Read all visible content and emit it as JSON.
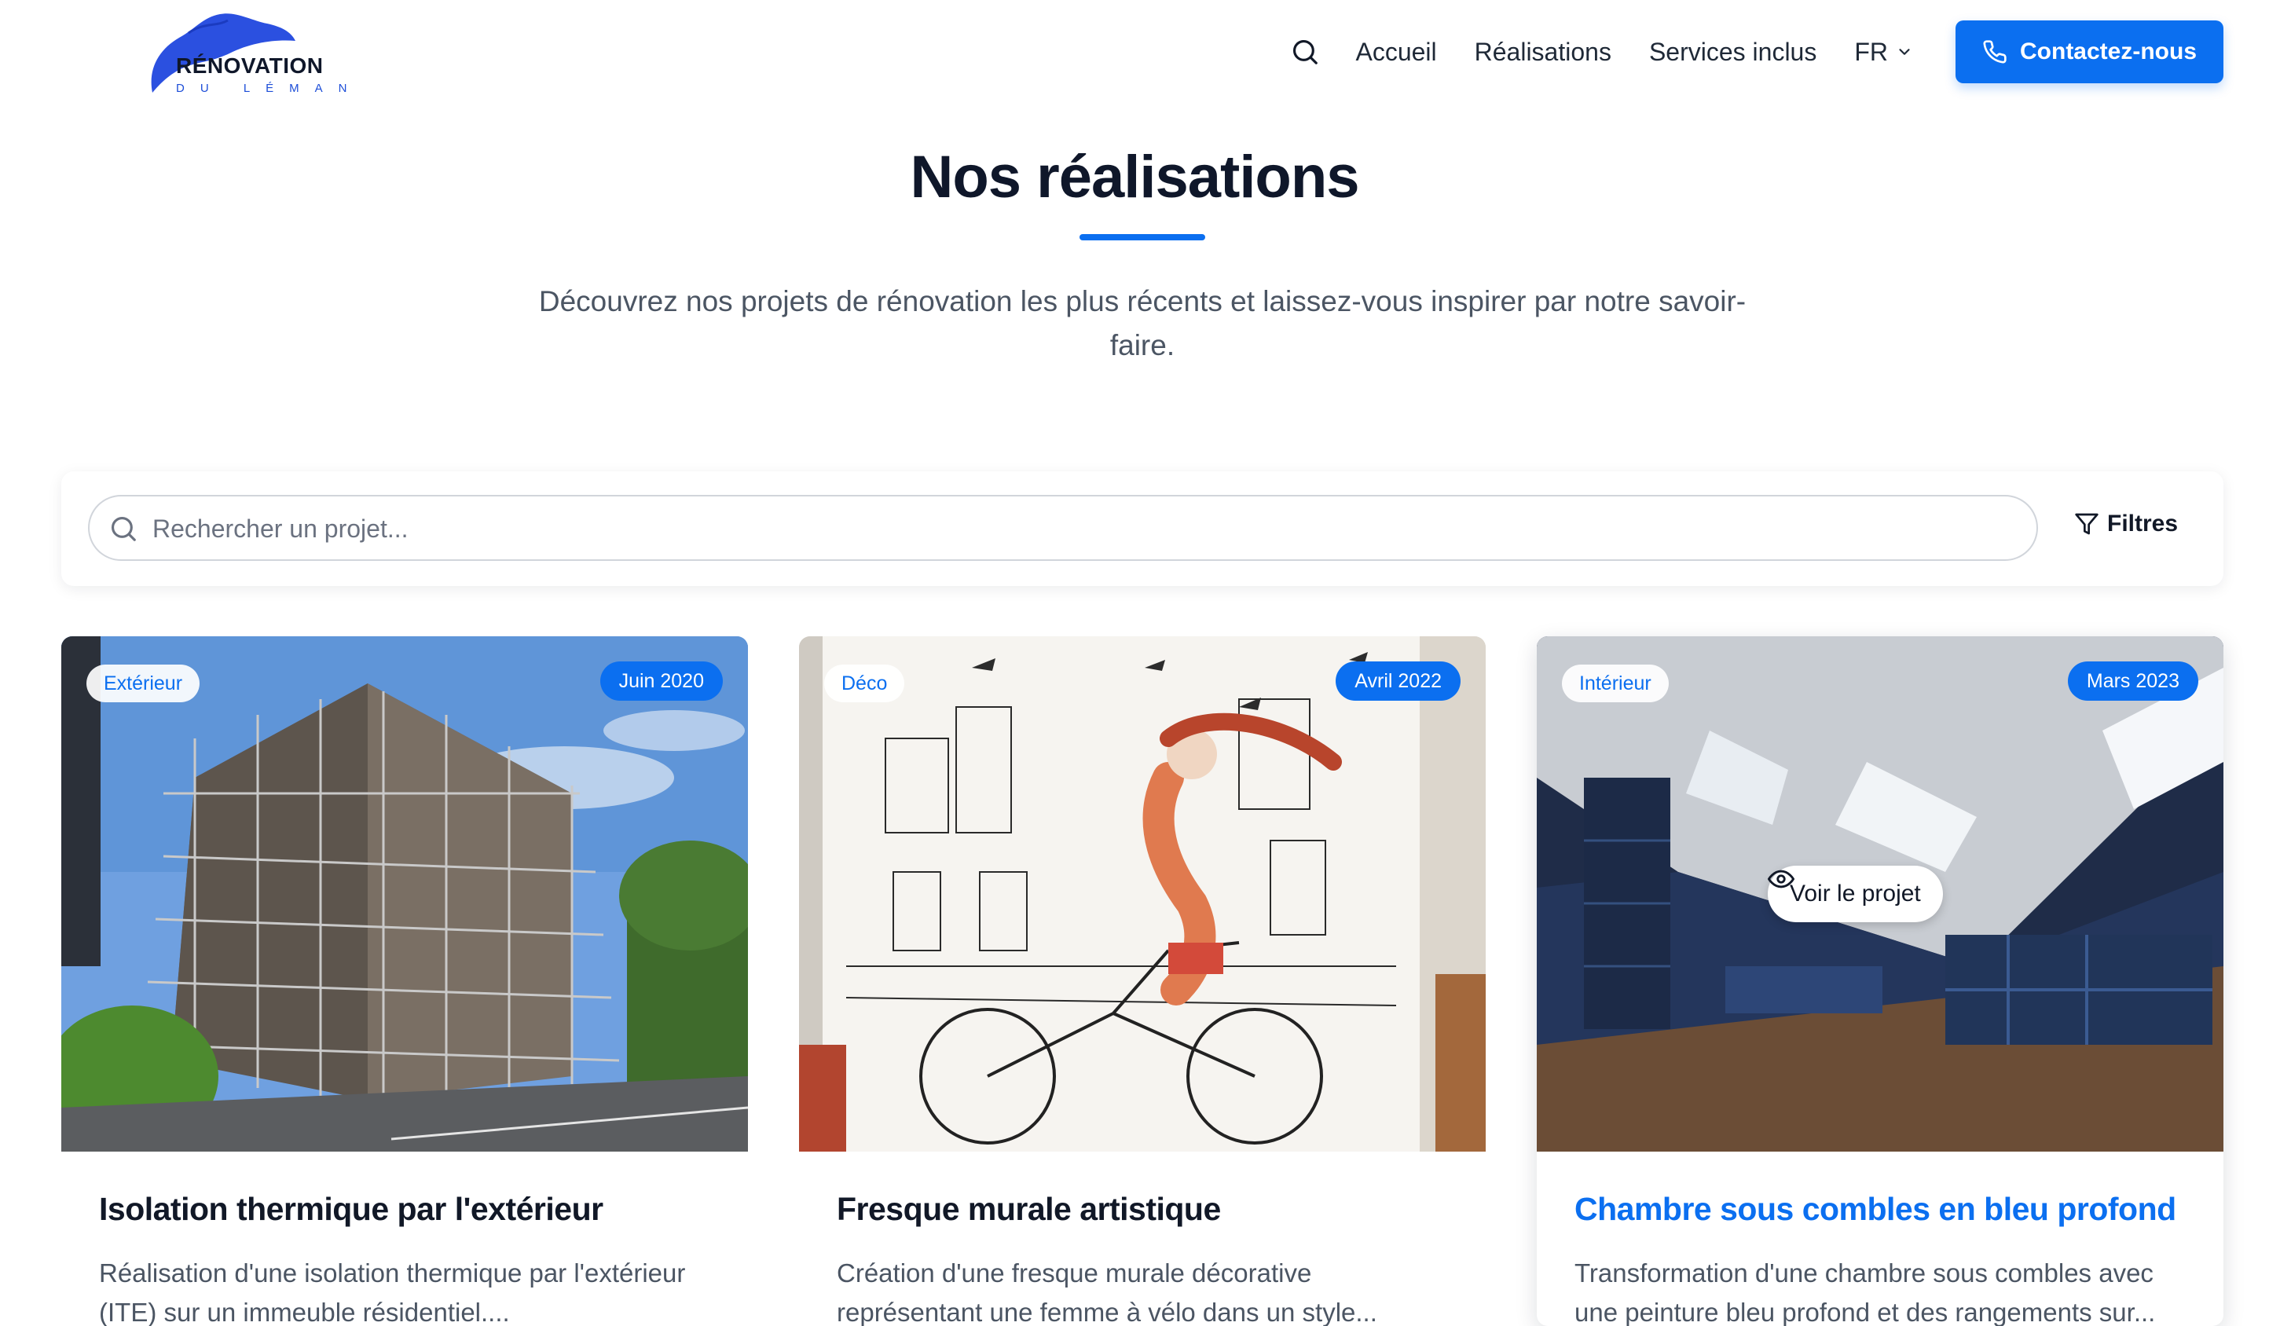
{
  "header": {
    "logo": {
      "word": "RÉNOVATION",
      "sub": "DU LÉMAN"
    },
    "nav": [
      {
        "label": "Accueil"
      },
      {
        "label": "Réalisations"
      },
      {
        "label": "Services inclus"
      }
    ],
    "lang": "FR",
    "cta_label": "Contactez-nous"
  },
  "hero": {
    "title": "Nos réalisations",
    "subtitle": "Découvrez nos projets de rénovation les plus récents et laissez-vous inspirer par notre savoir-faire."
  },
  "search": {
    "placeholder": "Rechercher un projet...",
    "filters_label": "Filtres"
  },
  "projects": [
    {
      "category": "Extérieur",
      "date": "Juin 2020",
      "title": "Isolation thermique par l'extérieur",
      "description": "Réalisation d'une isolation thermique par l'extérieur (ITE) sur un immeuble résidentiel...."
    },
    {
      "category": "Déco",
      "date": "Avril 2022",
      "title": "Fresque murale artistique",
      "description": "Création d'une fresque murale décorative représentant une femme à vélo dans un style..."
    },
    {
      "category": "Intérieur",
      "date": "Mars 2023",
      "title": "Chambre sous combles en bleu profond",
      "description": "Transformation d'une chambre sous combles avec une peinture bleu profond et des rangements sur...",
      "overlay_label": "Voir le projet"
    }
  ],
  "colors": {
    "accent": "#0b6ff0",
    "heading": "#0f172a",
    "body_text": "#4b5563"
  }
}
